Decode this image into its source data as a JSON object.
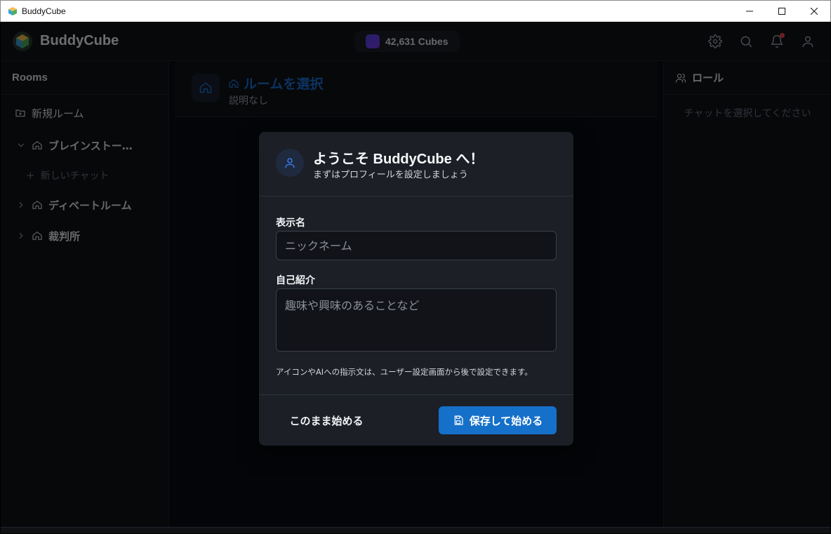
{
  "window": {
    "title": "BuddyCube"
  },
  "header": {
    "brand": "BuddyCube",
    "cubes": "42,631 Cubes",
    "accent": "#1570c9",
    "notification_dot_color": "#ef4444"
  },
  "sidebar": {
    "title": "Rooms",
    "new_room": "新規ルーム",
    "rooms": [
      {
        "label": "ブレインストー…",
        "expanded": true,
        "sub": "新しいチャット"
      },
      {
        "label": "ディベートルーム",
        "expanded": false
      },
      {
        "label": "裁判所",
        "expanded": false
      }
    ]
  },
  "room": {
    "title": "ルームを選択",
    "description": "説明なし"
  },
  "right_panel": {
    "title": "ロール",
    "empty": "チャットを選択してください"
  },
  "modal": {
    "title": "ようこそ BuddyCube へ！",
    "subtitle": "まずはプロフィールを設定しましょう",
    "display_name_label": "表示名",
    "display_name_placeholder": "ニックネーム",
    "bio_label": "自己紹介",
    "bio_placeholder": "趣味や興味のあることなど",
    "note": "アイコンやAIへの指示文は、ユーザー設定画面から後で設定できます。",
    "skip_button": "このまま始める",
    "save_button": "保存して始める"
  }
}
